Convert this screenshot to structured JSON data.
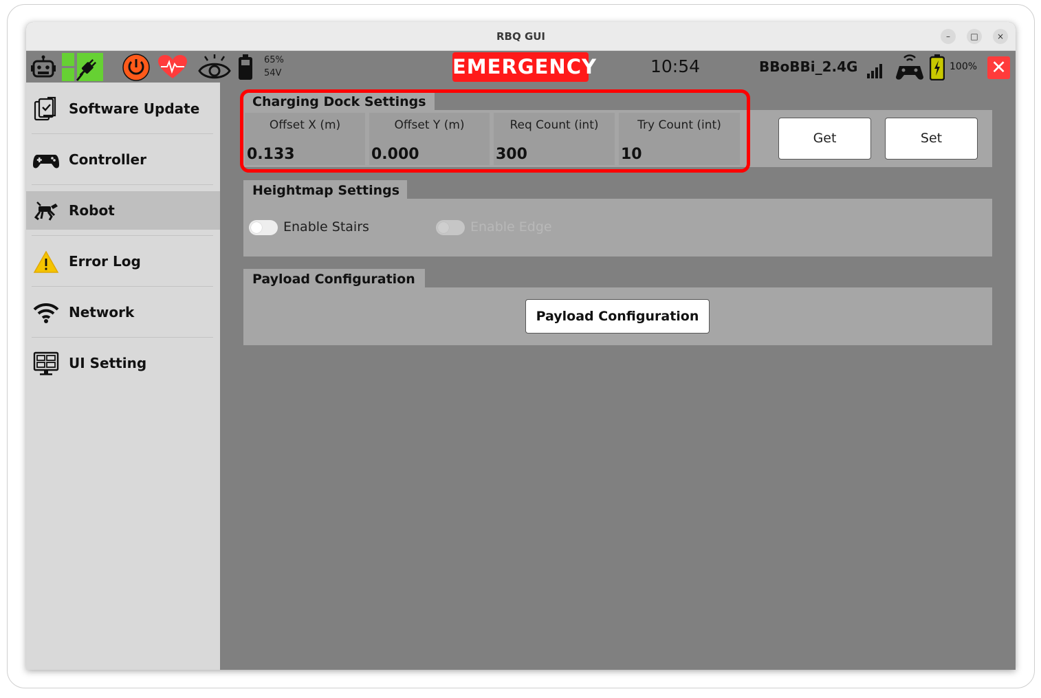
{
  "window": {
    "title": "RBQ GUI",
    "controls": {
      "minimize": "–",
      "maximize": "□",
      "close": "×"
    }
  },
  "toolbar": {
    "battery_percent": "65%",
    "battery_voltage": "54V",
    "emergency_label": "EMERGENCY",
    "clock": "10:54",
    "wifi_name": "BBoBBi_2.4G",
    "controller_battery": "100%",
    "close_symbol": "✕",
    "icons": [
      "robot-face-icon",
      "plug-connected-icon",
      "power-icon",
      "heartbeat-icon",
      "eye-icon",
      "battery-icon",
      "signal-bars-icon",
      "gamepad-wifi-icon",
      "charging-battery-icon",
      "close-icon"
    ],
    "colors": {
      "emergency": "#ff1a1a",
      "plug_bg": "#66d133",
      "power": "#ff5a1a",
      "heart": "#ff3b3b",
      "close": "#ff3b3b"
    }
  },
  "sidebar": {
    "items": [
      {
        "label": "Software Update",
        "icon": "software-update-icon"
      },
      {
        "label": "Controller",
        "icon": "gamepad-icon"
      },
      {
        "label": "Robot",
        "icon": "robot-dog-icon",
        "active": true
      },
      {
        "label": "Error Log",
        "icon": "warning-icon"
      },
      {
        "label": "Network",
        "icon": "wifi-icon"
      },
      {
        "label": "UI Setting",
        "icon": "monitor-settings-icon"
      }
    ]
  },
  "charging_dock": {
    "title": "Charging Dock Settings",
    "fields": [
      {
        "label": "Offset X (m)",
        "value": "0.133"
      },
      {
        "label": "Offset Y (m)",
        "value": "0.000"
      },
      {
        "label": "Req Count (int)",
        "value": "300"
      },
      {
        "label": "Try Count (int)",
        "value": "10"
      }
    ],
    "get_label": "Get",
    "set_label": "Set"
  },
  "heightmap": {
    "title": "Heightmap Settings",
    "stairs_label": "Enable Stairs",
    "edge_label": "Enable Edge"
  },
  "payload": {
    "title": "Payload Configuration",
    "button_label": "Payload Configuration"
  }
}
